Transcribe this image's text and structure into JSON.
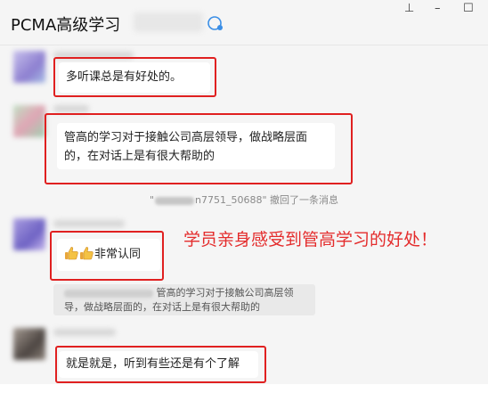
{
  "window": {
    "title": "PCMA高级学习",
    "minimize_glyph": "–",
    "pin_glyph": "⊥",
    "maximize_glyph": "☐"
  },
  "messages": [
    {
      "text": "多听课总是有好处的。"
    },
    {
      "text": "管高的学习对于接触公司高层领导，做战略层面的，在对话上是有很大帮助的"
    },
    {
      "recall_prefix": "\"",
      "recall_visible": "n7751_50688\"",
      "recall_action": "撤回了一条消息"
    },
    {
      "text": "非常认同",
      "emoji": "thumbs-up-icon",
      "quote_text": "管高的学习对于接触公司高层领导，做战略层面的，在对话上是有很大帮助的"
    },
    {
      "text": "就是就是，听到有些还是有个了解"
    }
  ],
  "annotation": "学员亲身感受到管高学习的好处！",
  "colors": {
    "highlight_border": "#e02020",
    "annotation_text": "#e42c2c",
    "chat_background": "#f5f5f5"
  }
}
